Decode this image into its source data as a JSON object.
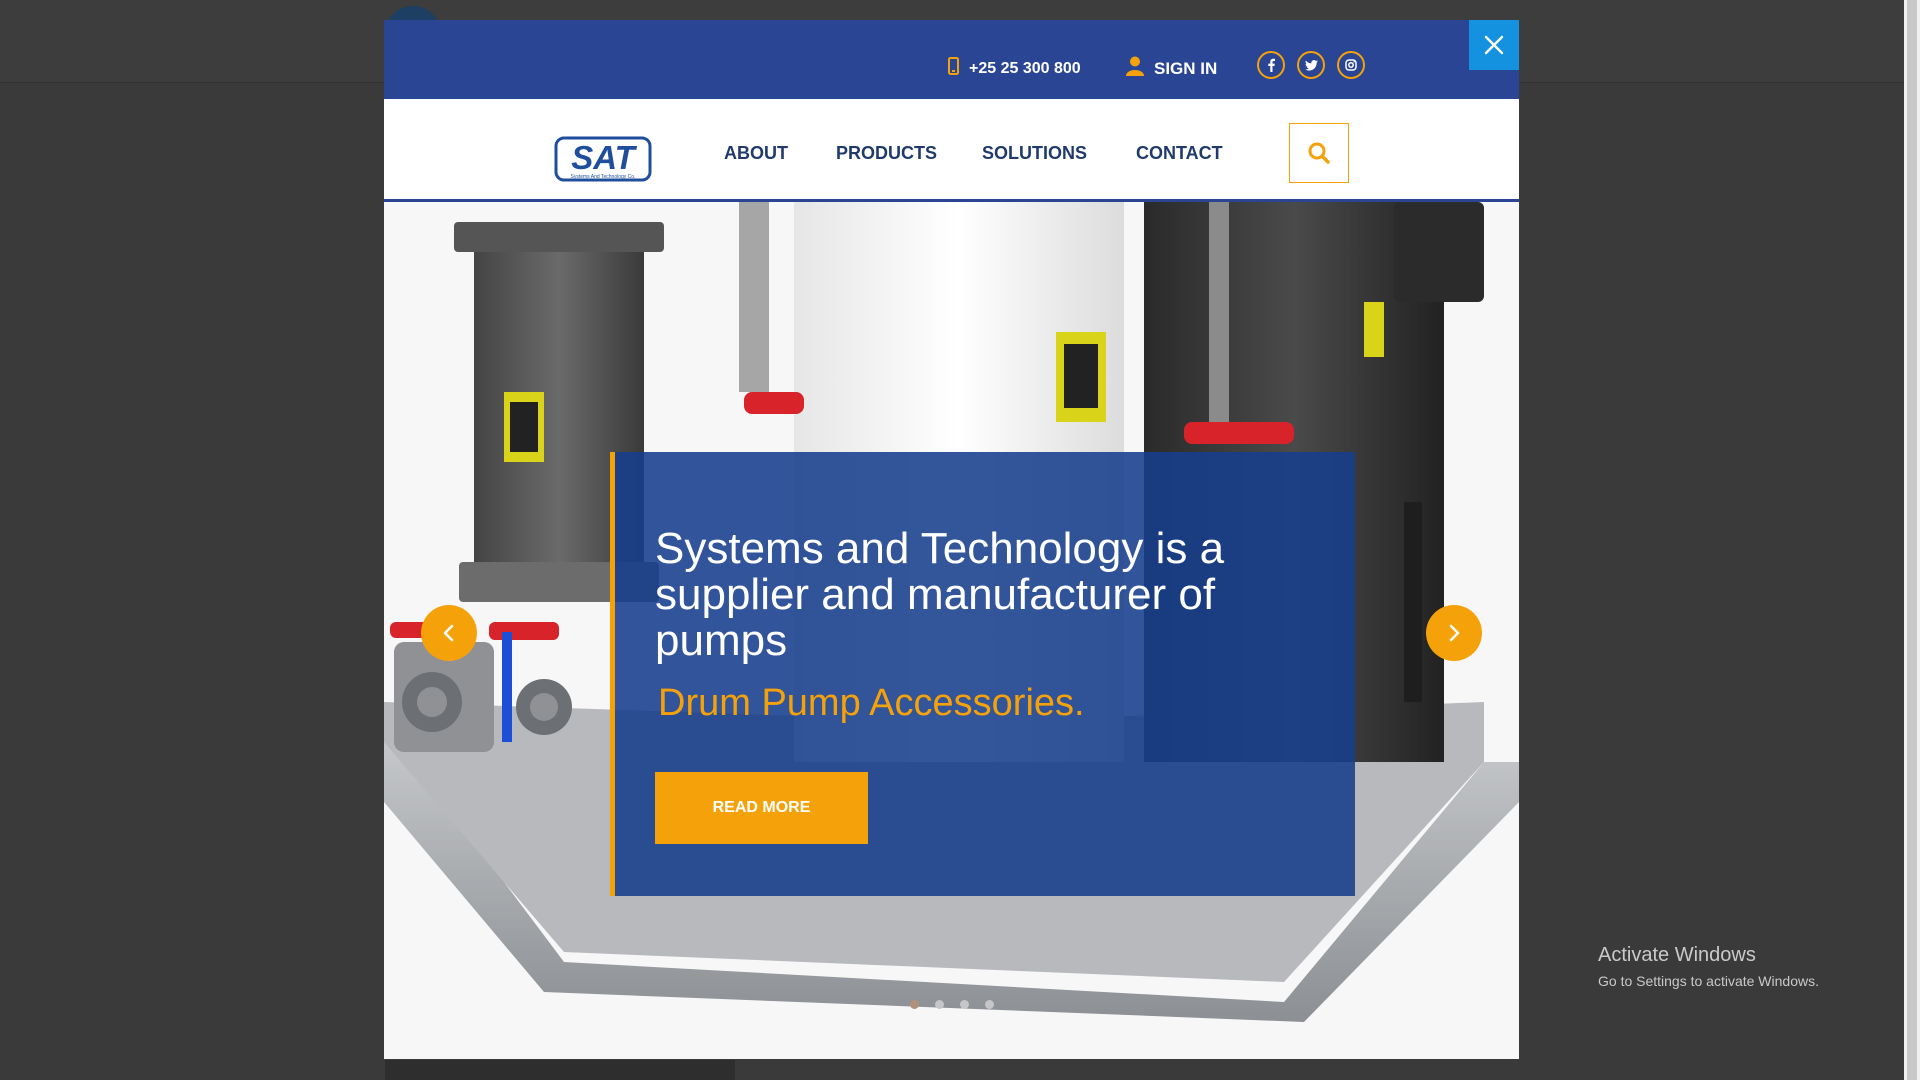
{
  "topbar": {
    "phone": "+25 25 300 800",
    "signin_label": "SIGN IN",
    "social_icons": [
      "facebook-icon",
      "twitter-icon",
      "instagram-icon"
    ]
  },
  "logo": {
    "text": "SAT",
    "tagline": "Systems And Technology Co."
  },
  "nav": {
    "items": [
      "ABOUT",
      "PRODUCTS",
      "SOLUTIONS",
      "CONTACT"
    ]
  },
  "hero": {
    "headline": "Systems and Technology is a supplier and manufacturer of pumps",
    "subline": "Drum Pump Accessories.",
    "cta_label": "READ MORE",
    "slide_count": 4,
    "active_slide": 1
  },
  "overlay": {
    "line1": "Activate Windows",
    "line2": "Go to Settings to activate Windows."
  },
  "colors": {
    "brand_blue": "#2a4593",
    "accent_orange": "#f5a20a",
    "close_blue": "#1592df",
    "nav_text": "#1f3a6b"
  }
}
